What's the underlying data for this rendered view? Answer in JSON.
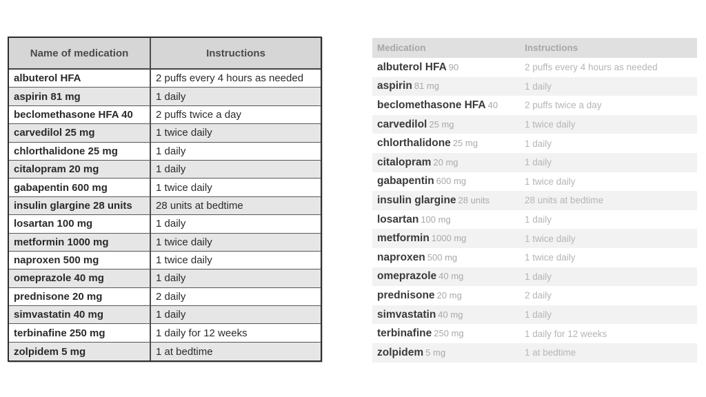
{
  "left_table": {
    "headers": {
      "name": "Name of medication",
      "instructions": "Instructions"
    },
    "rows": [
      {
        "name": "albuterol HFA",
        "instructions": "2 puffs every 4 hours as needed"
      },
      {
        "name": "aspirin 81 mg",
        "instructions": "1 daily"
      },
      {
        "name": "beclomethasone HFA 40",
        "instructions": "2 puffs twice a day"
      },
      {
        "name": "carvedilol 25 mg",
        "instructions": "1 twice daily"
      },
      {
        "name": "chlorthalidone 25 mg",
        "instructions": "1 daily"
      },
      {
        "name": "citalopram 20 mg",
        "instructions": "1 daily"
      },
      {
        "name": "gabapentin 600 mg",
        "instructions": "1 twice daily"
      },
      {
        "name": "insulin glargine 28 units",
        "instructions": "28 units at bedtime"
      },
      {
        "name": "losartan 100 mg",
        "instructions": "1 daily"
      },
      {
        "name": "metformin 1000 mg",
        "instructions": "1 twice daily"
      },
      {
        "name": "naproxen 500 mg",
        "instructions": "1 twice daily"
      },
      {
        "name": "omeprazole 40 mg",
        "instructions": "1 daily"
      },
      {
        "name": "prednisone 20 mg",
        "instructions": "2 daily"
      },
      {
        "name": "simvastatin 40 mg",
        "instructions": "1 daily"
      },
      {
        "name": "terbinafine 250 mg",
        "instructions": "1 daily for 12 weeks"
      },
      {
        "name": "zolpidem 5 mg",
        "instructions": "1 at bedtime"
      }
    ]
  },
  "right_table": {
    "headers": {
      "name": "Medication",
      "instructions": "Instructions"
    },
    "rows": [
      {
        "drug": "albuterol HFA",
        "dose": "90",
        "instructions": "2 puffs every 4 hours as needed"
      },
      {
        "drug": "aspirin",
        "dose": "81 mg",
        "instructions": "1 daily"
      },
      {
        "drug": "beclomethasone HFA",
        "dose": "40",
        "instructions": "2 puffs twice a day"
      },
      {
        "drug": "carvedilol",
        "dose": "25 mg",
        "instructions": "1 twice daily"
      },
      {
        "drug": "chlorthalidone",
        "dose": "25 mg",
        "instructions": "1 daily"
      },
      {
        "drug": "citalopram",
        "dose": "20 mg",
        "instructions": "1 daily"
      },
      {
        "drug": "gabapentin",
        "dose": "600 mg",
        "instructions": "1 twice daily"
      },
      {
        "drug": "insulin glargine",
        "dose": "28 units",
        "instructions": "28 units at bedtime"
      },
      {
        "drug": "losartan",
        "dose": "100 mg",
        "instructions": "1 daily"
      },
      {
        "drug": "metformin",
        "dose": "1000 mg",
        "instructions": "1 twice daily"
      },
      {
        "drug": "naproxen",
        "dose": "500 mg",
        "instructions": "1 twice daily"
      },
      {
        "drug": "omeprazole",
        "dose": "40 mg",
        "instructions": "1 daily"
      },
      {
        "drug": "prednisone",
        "dose": "20  mg",
        "instructions": "2 daily"
      },
      {
        "drug": "simvastatin",
        "dose": "40 mg",
        "instructions": "1 daily"
      },
      {
        "drug": "terbinafine",
        "dose": "250 mg",
        "instructions": "1 daily for 12 weeks"
      },
      {
        "drug": "zolpidem",
        "dose": "5 mg",
        "instructions": "1 at bedtime"
      }
    ]
  }
}
